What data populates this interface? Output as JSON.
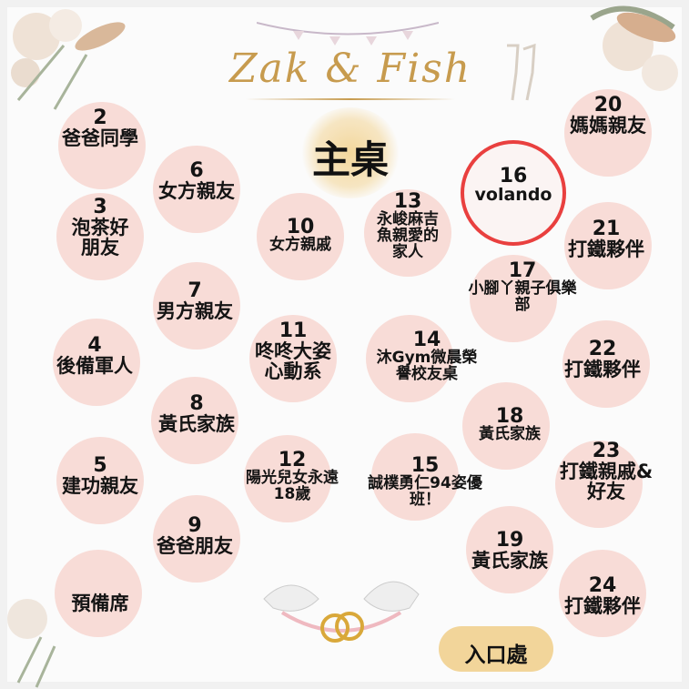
{
  "header": {
    "title": "Zak & Fish"
  },
  "main_table": {
    "label": "主桌"
  },
  "entrance": {
    "label": "入口處"
  },
  "tables": [
    {
      "number": "2",
      "name": "爸爸同學"
    },
    {
      "number": "6",
      "name": "女方親友"
    },
    {
      "number": "3",
      "name": "泡茶好朋友"
    },
    {
      "number": "10",
      "name": "女方親戚"
    },
    {
      "number": "13",
      "name": "永峻麻吉魚親愛的家人"
    },
    {
      "number": "16",
      "name": "volando"
    },
    {
      "number": "20",
      "name": "媽媽親友"
    },
    {
      "number": "21",
      "name": "打鐵夥伴"
    },
    {
      "number": "7",
      "name": "男方親友"
    },
    {
      "number": "17",
      "name": "小腳丫親子俱樂部"
    },
    {
      "number": "4",
      "name": "後備軍人"
    },
    {
      "number": "11",
      "name": "咚咚大姿心動系"
    },
    {
      "number": "14",
      "name": "沐Gym微晨榮譽校友桌"
    },
    {
      "number": "22",
      "name": "打鐵夥伴"
    },
    {
      "number": "8",
      "name": "黃氏家族"
    },
    {
      "number": "18",
      "name": "黃氏家族"
    },
    {
      "number": "5",
      "name": "建功親友"
    },
    {
      "number": "12",
      "name": "陽光兒女永遠18歲"
    },
    {
      "number": "15",
      "name": "誠樸勇仁94姿優班！"
    },
    {
      "number": "23",
      "name": "打鐵親戚&好友"
    },
    {
      "number": "9",
      "name": "爸爸朋友"
    },
    {
      "number": "19",
      "name": "黃氏家族"
    },
    {
      "number": "24",
      "name": "打鐵夥伴"
    },
    {
      "number": "",
      "name": "預備席"
    }
  ]
}
